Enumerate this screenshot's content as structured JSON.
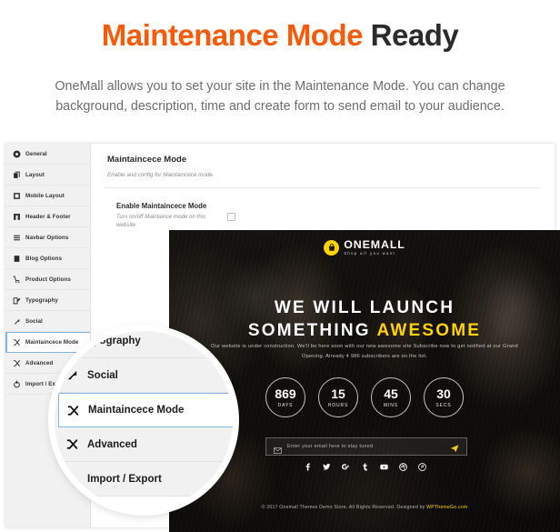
{
  "header": {
    "title_orange": "Maintenance Mode",
    "title_dark": "Ready",
    "subtitle": "OneMall allows you to set your site in the Maintenance Mode. You can change background, description, time and create form to send email to your audience."
  },
  "colors": {
    "accent_orange": "#f95a07",
    "accent_yellow": "#ffd200",
    "title_dark": "#2b2b2b",
    "active_blue": "#7fb4e3"
  },
  "admin": {
    "sidebar": {
      "items": [
        {
          "label": "General",
          "icon": "gear-icon",
          "active": false
        },
        {
          "label": "Layout",
          "icon": "layers-icon",
          "active": false
        },
        {
          "label": "Mobile Layout",
          "icon": "mobile-icon",
          "active": false
        },
        {
          "label": "Header & Footer",
          "icon": "header-footer-icon",
          "active": false
        },
        {
          "label": "Navbar Options",
          "icon": "menu-bars-icon",
          "active": false
        },
        {
          "label": "Blog Options",
          "icon": "blog-icon",
          "active": false
        },
        {
          "label": "Product Options",
          "icon": "cart-icon",
          "active": false
        },
        {
          "label": "Typography",
          "icon": "pencil-square-icon",
          "active": false
        },
        {
          "label": "Social",
          "icon": "share-icon",
          "active": false
        },
        {
          "label": "Maintaincece Mode",
          "icon": "shuffle-icon",
          "active": true
        },
        {
          "label": "Advanced",
          "icon": "shuffle-icon",
          "active": false
        },
        {
          "label": "Import / Export",
          "icon": "power-icon",
          "active": false
        }
      ]
    },
    "content": {
      "title": "Maintaincece Mode",
      "subtitle": "Enable and config for Maintaincece mode.",
      "field_title": "Enable Maintaincece Mode",
      "field_desc": "Turn on/off Maintaince mode on this website",
      "checkbox_checked": false
    }
  },
  "magnifier": {
    "items": [
      {
        "label": "ypography",
        "icon": "pencil-square-icon",
        "active": false
      },
      {
        "label": "Social",
        "icon": "share-icon",
        "active": false
      },
      {
        "label": "Maintaincece Mode",
        "icon": "shuffle-icon",
        "active": true
      },
      {
        "label": "Advanced",
        "icon": "shuffle-icon",
        "active": false
      },
      {
        "label": "Import / Export",
        "icon": "power-icon",
        "active": false
      }
    ]
  },
  "hero": {
    "logo_name": "ONEMALL",
    "logo_tagline": "Shop all you want",
    "logo_icon": "shopping-bag-icon",
    "heading_line1": "WE WILL LAUNCH",
    "heading_line2_plain": "SOMETHING ",
    "heading_line2_accent": "AWESOME",
    "description": "Our website is under construction. We'll be here soon with our new awesome site Subscribe now to get notified at our Grand Opening. Already 4 986 subscribers are on the list.",
    "countdown": [
      {
        "value": "869",
        "label": "DAYS"
      },
      {
        "value": "15",
        "label": "HOURS"
      },
      {
        "value": "45",
        "label": "MINS"
      },
      {
        "value": "30",
        "label": "SECS"
      }
    ],
    "subscribe": {
      "placeholder": "Enter your email here to stay tuned",
      "value": "",
      "envelope_icon": "envelope-icon",
      "send_icon": "paper-plane-icon"
    },
    "socials": [
      "facebook-icon",
      "twitter-icon",
      "google-plus-icon",
      "tumblr-icon",
      "youtube-icon",
      "dribbble-icon",
      "pinterest-icon"
    ],
    "footer_text": "© 2017 Onemall Themes Demo Store. All Rights Reserved. Designed by ",
    "footer_link": "WPThemeGo.com"
  }
}
